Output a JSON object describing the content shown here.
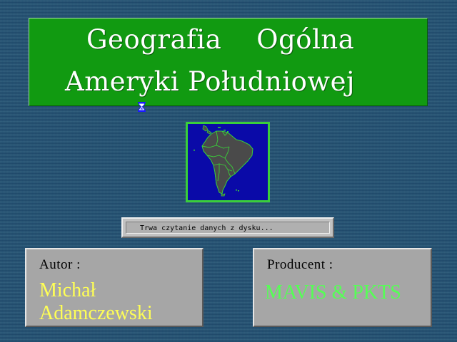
{
  "title": {
    "line1": "Geografia    Ogólna",
    "line2": "Ameryki Południowej"
  },
  "cursor": {
    "icon": "hourglass-icon"
  },
  "map": {
    "subject": "South America",
    "colors": {
      "frame": "#3acf3a",
      "ocean": "#0a0aa8",
      "land": "#4a4a4a",
      "borders": "#3acf3a"
    }
  },
  "status": {
    "text": "Trwa czytanie danych z dysku..."
  },
  "author": {
    "label": "Autor :",
    "name_line1": "Michał",
    "name_line2": "Adamczewski"
  },
  "producer": {
    "label": "Producent :",
    "name": "MAVIS & PKTS"
  },
  "colors": {
    "background": "#2d5b7a",
    "title_panel": "#119a11",
    "author_name": "#ffff55",
    "producer_name": "#55ff55",
    "card": "#a6a6a6"
  }
}
